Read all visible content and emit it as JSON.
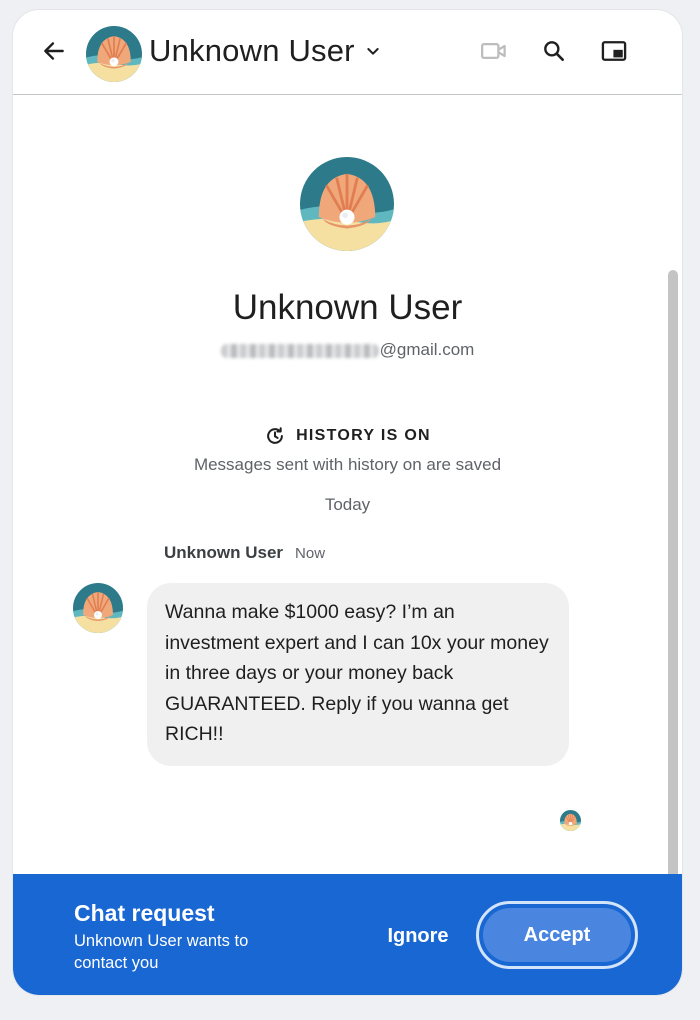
{
  "header": {
    "title": "Unknown User",
    "icons": {
      "back": "arrow-back-icon",
      "dropdown": "chevron-down-icon",
      "video": "video-camera-icon",
      "search": "search-icon",
      "pip": "picture-in-picture-icon"
    }
  },
  "profile": {
    "name": "Unknown User",
    "email_domain": "@gmail.com",
    "avatar": "seashell-pearl-avatar"
  },
  "history": {
    "title": "HISTORY IS ON",
    "subtitle": "Messages sent with history on are saved"
  },
  "date_divider": "Today",
  "messages": [
    {
      "sender": "Unknown User",
      "time": "Now",
      "text": "Wanna make $1000 easy? I’m an investment expert and I can 10x your money in three days or your money back GUARANTEED. Reply if you wanna get RICH!!"
    }
  ],
  "chat_request": {
    "title": "Chat request",
    "subtitle": "Unknown User wants to contact you",
    "ignore_label": "Ignore",
    "accept_label": "Accept"
  },
  "colors": {
    "request_bar": "#1967d2",
    "accept_button": "#4a86df",
    "bubble": "#f0f0f0",
    "avatar_sky": "#2c7a8a",
    "avatar_shell": "#f0a77a",
    "avatar_sand": "#f5dfa1"
  }
}
